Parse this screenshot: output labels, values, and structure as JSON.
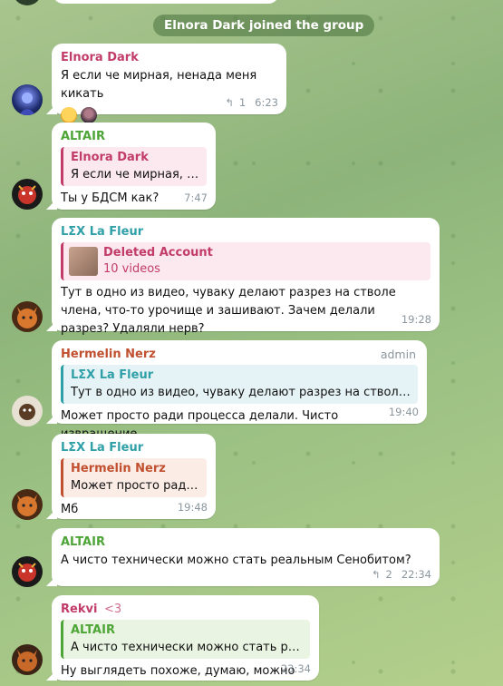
{
  "service_message": "Elnora Dark joined the group",
  "colors": {
    "elnora": "#c23c6a",
    "altair": "#4ea537",
    "lex": "#2f9fa8",
    "hermelin": "#c0502f",
    "rekvi": "#c23c6a",
    "quote_pink_bg": "#fbe9ef",
    "quote_green_bg": "#e9f5e2",
    "quote_blue_bg": "#e6f3f6"
  },
  "messages": [
    {
      "author": "Elnora Dark",
      "text": "Я если че мирная, ненада меня кикать",
      "reply_count": "1",
      "time": "6:23",
      "reactions": [
        "face-emoji",
        "user-avatar-reaction"
      ]
    },
    {
      "author": "ALTAIR",
      "reply_to_name": "Elnora Dark",
      "reply_to_text": "Я если че мирная, не...",
      "text": "Ты у БДСМ как?",
      "time": "7:47"
    },
    {
      "author": "LΣX La Fleur",
      "reply_to_name": "Deleted Account",
      "reply_to_text": "10 videos",
      "text": "Тут в одно из видео, чуваку делают разрез на стволе члена, что-то урочище и зашивают. Зачем делали разрез? Удаляли нерв?",
      "time": "19:28"
    },
    {
      "author": "Hermelin Nerz",
      "admin_label": "admin",
      "reply_to_name": "LΣX La Fleur",
      "reply_to_text": "Тут в одно из видео, чуваку делают разрез на стволе члена...",
      "text": "Может просто ради процесса делали. Чисто извращение",
      "time": "19:40"
    },
    {
      "author": "LΣX La Fleur",
      "reply_to_name": "Hermelin Nerz",
      "reply_to_text": "Может просто ради п...",
      "text": "Мб",
      "time": "19:48"
    },
    {
      "author": "ALTAIR",
      "text": "А чисто технически можно стать реальным Сенобитом?",
      "reply_count": "2",
      "time": "22:34"
    },
    {
      "author": "Rekvi",
      "author_suffix": "<3",
      "reply_to_name": "ALTAIR",
      "reply_to_text": "А чисто технически можно стать реаль...",
      "text": "Ну выглядеть похоже, думаю, можно",
      "time": "23:34"
    }
  ]
}
